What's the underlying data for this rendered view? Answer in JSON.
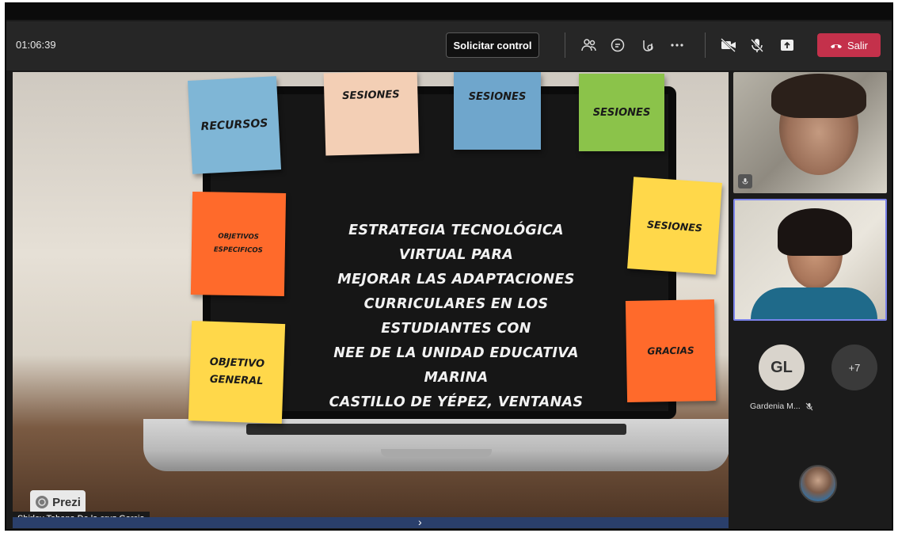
{
  "window": {
    "title": ""
  },
  "toolbar": {
    "timer": "01:06:39",
    "request_control_label": "Solicitar control",
    "icons": [
      "people-icon",
      "chat-icon",
      "reactions-icon",
      "more-icon",
      "camera-off-icon",
      "mic-off-icon",
      "share-icon"
    ],
    "leave_label": "Salir",
    "leave_color": "#c4314b"
  },
  "slide": {
    "title_lines": [
      "ESTRATEGIA TECNOLÓGICA VIRTUAL PARA",
      "MEJORAR LAS ADAPTACIONES",
      "CURRICULARES EN LOS ESTUDIANTES CON",
      "NEE DE LA UNIDAD EDUCATIVA MARINA",
      "CASTILLO DE YÉPEZ, VENTANAS"
    ],
    "notes": {
      "recursos": "RECURSOS",
      "sesiones_1": "SESIONES",
      "sesiones_2": "SESIONES",
      "sesiones_3": "SESIONES",
      "sesiones_4": "SESIONES",
      "objetivos_line1": "OBJETIVOS",
      "objetivos_line2": "ESPECIFICOS",
      "general_line1": "OBJETIVO",
      "general_line2": "GENERAL",
      "gracias": "GRACIAS"
    },
    "prezi_label": "Prezi"
  },
  "presenter_name": "Shirley Tabana De la cruz Garcia",
  "participants": {
    "gl_initials": "GL",
    "gl_name": "Gardenia M...",
    "more_count": "+7"
  },
  "colors": {
    "blue_note": "#7fb6d6",
    "peach_note": "#f3cfb5",
    "green_note": "#8bc34a",
    "orange_note": "#ff6a2b",
    "yellow_note": "#ffd84a"
  }
}
